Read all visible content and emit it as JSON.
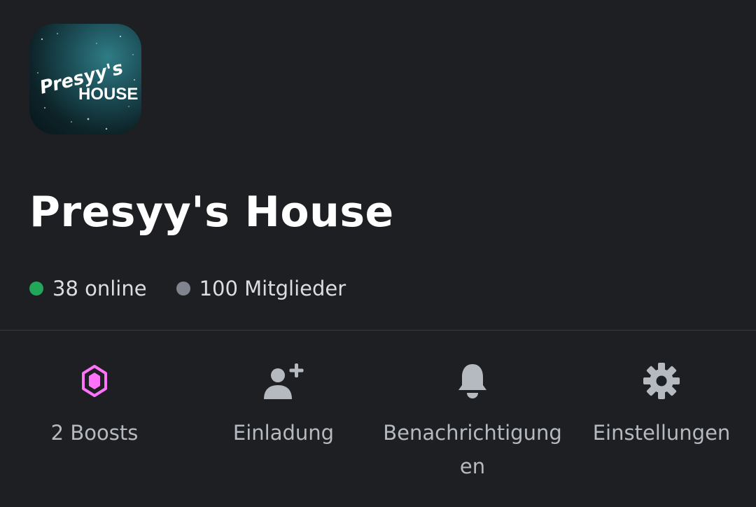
{
  "server": {
    "name": "Presyy's House",
    "icon_text_top": "Presyy's",
    "icon_text_bottom": "HOUSE"
  },
  "stats": {
    "online_label": "38 online",
    "members_label": "100 Mitglieder",
    "online_color": "#23a55a",
    "members_color": "#80848e"
  },
  "actions": [
    {
      "icon": "boost-gem-icon",
      "label": "2 Boosts",
      "color": "#ff73fa"
    },
    {
      "icon": "add-user-icon",
      "label": "Einladung"
    },
    {
      "icon": "bell-icon",
      "label": "Benachrichtigungen"
    },
    {
      "icon": "gear-icon",
      "label": "Einstellungen"
    }
  ],
  "colors": {
    "background": "#1e1f22",
    "title": "#ffffff",
    "muted": "#b5bac1",
    "divider": "#3a3b40"
  }
}
